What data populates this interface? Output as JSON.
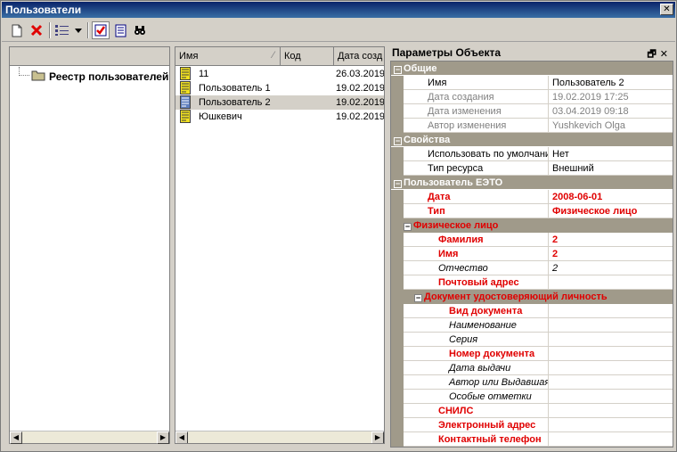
{
  "window": {
    "title": "Пользователи",
    "close": "✕"
  },
  "toolbar": {
    "icons": [
      "new-document-icon",
      "delete-icon",
      "view-list-icon",
      "dropdown-arrow-icon",
      "check-icon",
      "properties-icon",
      "search-binoculars-icon"
    ]
  },
  "tree": {
    "root_label": "Реестр пользователей"
  },
  "list": {
    "columns": [
      "Имя",
      "Код",
      "Дата созд"
    ],
    "rows": [
      {
        "name": "11",
        "code": "",
        "date": "26.03.2019",
        "selected": false
      },
      {
        "name": "Пользователь 1",
        "code": "",
        "date": "19.02.2019",
        "selected": false
      },
      {
        "name": "Пользователь 2",
        "code": "",
        "date": "19.02.2019",
        "selected": true
      },
      {
        "name": "Юшкевич",
        "code": "",
        "date": "19.02.2019",
        "selected": false
      }
    ]
  },
  "props": {
    "title": "Параметры Объекта",
    "pin": "🗗",
    "close": "✕",
    "rows": [
      {
        "type": "cat",
        "key": "Общие"
      },
      {
        "type": "item",
        "key": "Имя",
        "value": "Пользователь 2"
      },
      {
        "type": "dis",
        "key": "Дата создания",
        "value": "19.02.2019 17:25"
      },
      {
        "type": "dis",
        "key": "Дата изменения",
        "value": "03.04.2019 09:18"
      },
      {
        "type": "dis",
        "key": "Автор изменения",
        "value": "Yushkevich Olga"
      },
      {
        "type": "cat",
        "key": "Свойства"
      },
      {
        "type": "item",
        "key": "Использовать по умолчанию",
        "value": "Нет"
      },
      {
        "type": "item",
        "key": "Тип ресурса",
        "value": "Внешний"
      },
      {
        "type": "cat",
        "key": "Пользователь ЕЭТО"
      },
      {
        "type": "red",
        "indent": 1,
        "key": "Дата",
        "value": "2008-06-01"
      },
      {
        "type": "red",
        "indent": 1,
        "key": "Тип",
        "value": "Физическое лицо"
      },
      {
        "type": "subcat",
        "indent": 1,
        "key": "Физическое лицо"
      },
      {
        "type": "red",
        "indent": 2,
        "key": "Фамилия",
        "value": "2"
      },
      {
        "type": "red",
        "indent": 2,
        "key": "Имя",
        "value": "2"
      },
      {
        "type": "ital",
        "indent": 2,
        "key": "Отчество",
        "value": "2"
      },
      {
        "type": "red",
        "indent": 2,
        "key": "Почтовый адрес",
        "value": ""
      },
      {
        "type": "subcat",
        "indent": 2,
        "key": "Документ удостоверяющий личность"
      },
      {
        "type": "red",
        "indent": 3,
        "key": "Вид документа",
        "value": ""
      },
      {
        "type": "ital",
        "indent": 3,
        "key": "Наименование",
        "value": ""
      },
      {
        "type": "ital",
        "indent": 3,
        "key": "Серия",
        "value": ""
      },
      {
        "type": "red",
        "indent": 3,
        "key": "Номер документа",
        "value": ""
      },
      {
        "type": "ital",
        "indent": 3,
        "key": "Дата выдачи",
        "value": ""
      },
      {
        "type": "ital",
        "indent": 3,
        "key": "Автор или Выдавшая ...",
        "value": ""
      },
      {
        "type": "ital",
        "indent": 3,
        "key": "Особые отметки",
        "value": ""
      },
      {
        "type": "red",
        "indent": 2,
        "key": "СНИЛС",
        "value": ""
      },
      {
        "type": "red",
        "indent": 2,
        "key": "Электронный адрес",
        "value": ""
      },
      {
        "type": "red",
        "indent": 2,
        "key": "Контактный телефон",
        "value": ""
      }
    ]
  },
  "colors": {
    "category_bg": "#a09a8a",
    "required_red": "#e00000",
    "titlebar": "#0a246a"
  }
}
